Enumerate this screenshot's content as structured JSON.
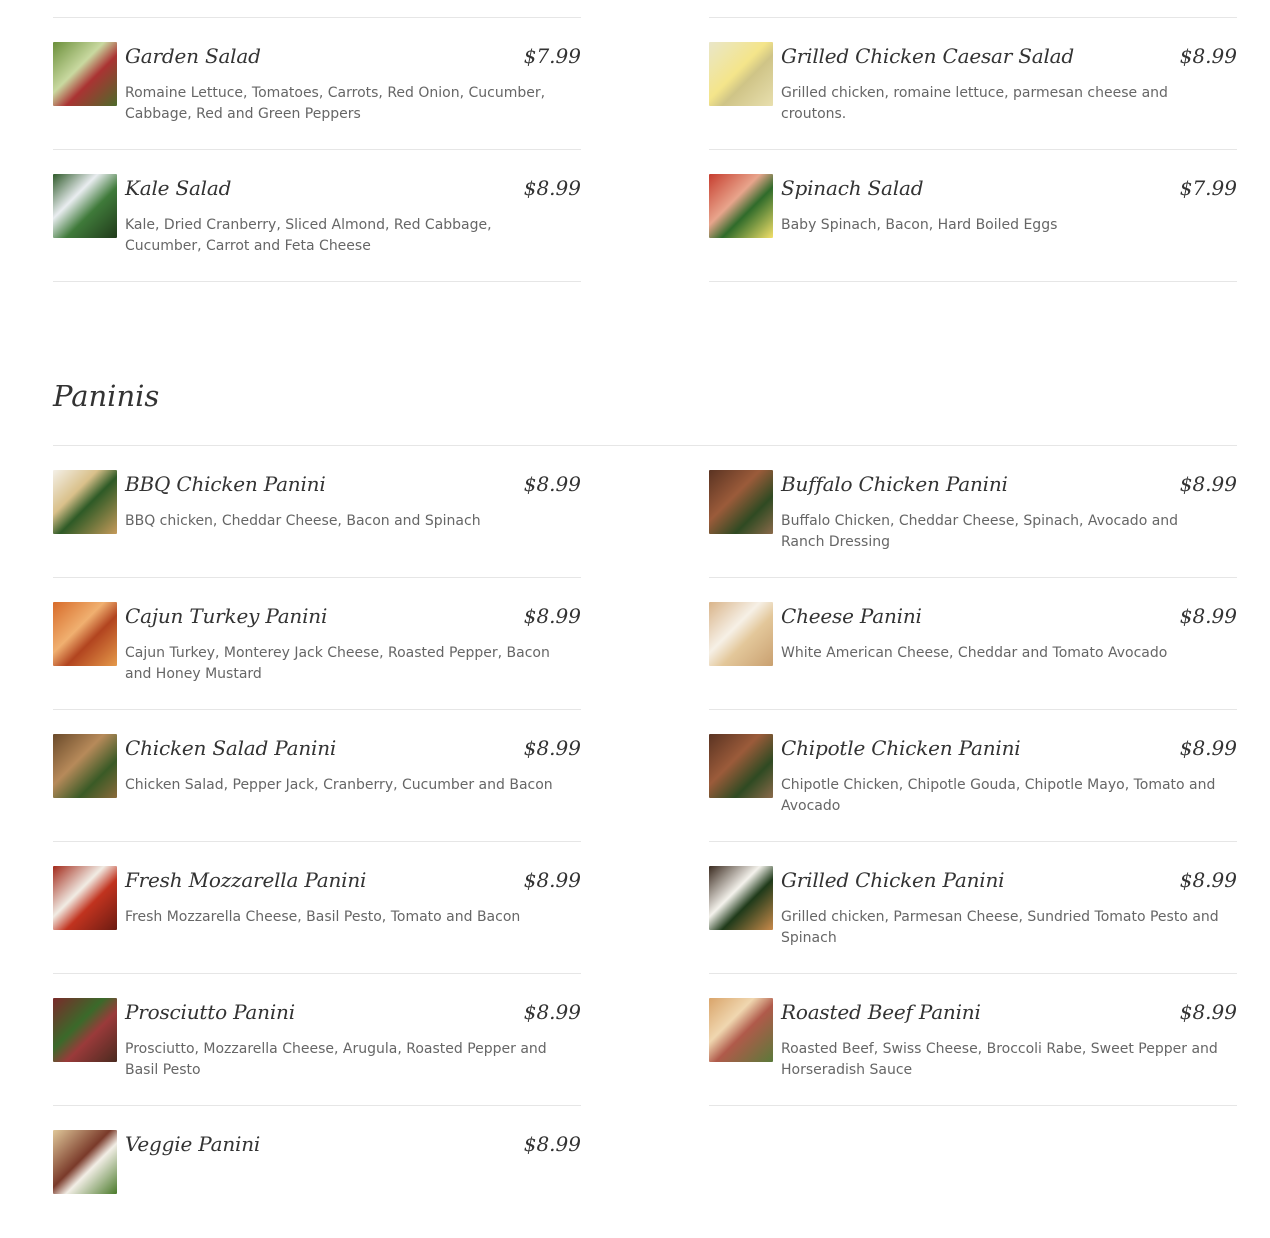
{
  "salads": {
    "left": [
      {
        "name": "Garden Salad",
        "price": "$7.99",
        "desc": "Romaine Lettuce, Tomatoes, Carrots, Red Onion, Cucumber, Cabbage, Red and Green Peppers"
      },
      {
        "name": "Kale Salad",
        "price": "$8.99",
        "desc": "Kale, Dried Cranberry, Sliced Almond, Red Cabbage, Cucumber, Carrot and Feta Cheese"
      }
    ],
    "right": [
      {
        "name": "Grilled Chicken Caesar Salad",
        "price": "$8.99",
        "desc": "Grilled chicken, romaine lettuce, parmesan cheese and croutons."
      },
      {
        "name": "Spinach Salad",
        "price": "$7.99",
        "desc": "Baby Spinach, Bacon, Hard Boiled Eggs"
      }
    ]
  },
  "paninis": {
    "title": "Paninis",
    "left": [
      {
        "name": "BBQ Chicken Panini",
        "price": "$8.99",
        "desc": "BBQ chicken, Cheddar Cheese, Bacon and Spinach"
      },
      {
        "name": "Cajun Turkey Panini",
        "price": "$8.99",
        "desc": "Cajun Turkey, Monterey Jack Cheese, Roasted Pepper, Bacon and Honey Mustard"
      },
      {
        "name": "Chicken Salad Panini",
        "price": "$8.99",
        "desc": "Chicken Salad, Pepper Jack, Cranberry, Cucumber and Bacon"
      },
      {
        "name": "Fresh Mozzarella Panini",
        "price": "$8.99",
        "desc": "Fresh Mozzarella Cheese, Basil Pesto, Tomato and Bacon"
      },
      {
        "name": "Prosciutto Panini",
        "price": "$8.99",
        "desc": "Prosciutto, Mozzarella Cheese, Arugula, Roasted Pepper and Basil Pesto"
      },
      {
        "name": "Veggie Panini",
        "price": "$8.99",
        "desc": ""
      }
    ],
    "right": [
      {
        "name": "Buffalo Chicken Panini",
        "price": "$8.99",
        "desc": "Buffalo Chicken, Cheddar Cheese, Spinach, Avocado and Ranch Dressing"
      },
      {
        "name": "Cheese Panini",
        "price": "$8.99",
        "desc": "White American Cheese, Cheddar and Tomato Avocado"
      },
      {
        "name": "Chipotle Chicken Panini",
        "price": "$8.99",
        "desc": "Chipotle Chicken, Chipotle Gouda, Chipotle Mayo, Tomato and Avocado"
      },
      {
        "name": "Grilled Chicken Panini",
        "price": "$8.99",
        "desc": "Grilled chicken, Parmesan Cheese, Sundried Tomato Pesto and Spinach"
      },
      {
        "name": "Roasted Beef Panini",
        "price": "$8.99",
        "desc": "Roasted Beef, Swiss Cheese, Broccoli Rabe, Sweet Pepper and Horseradish Sauce"
      }
    ]
  }
}
